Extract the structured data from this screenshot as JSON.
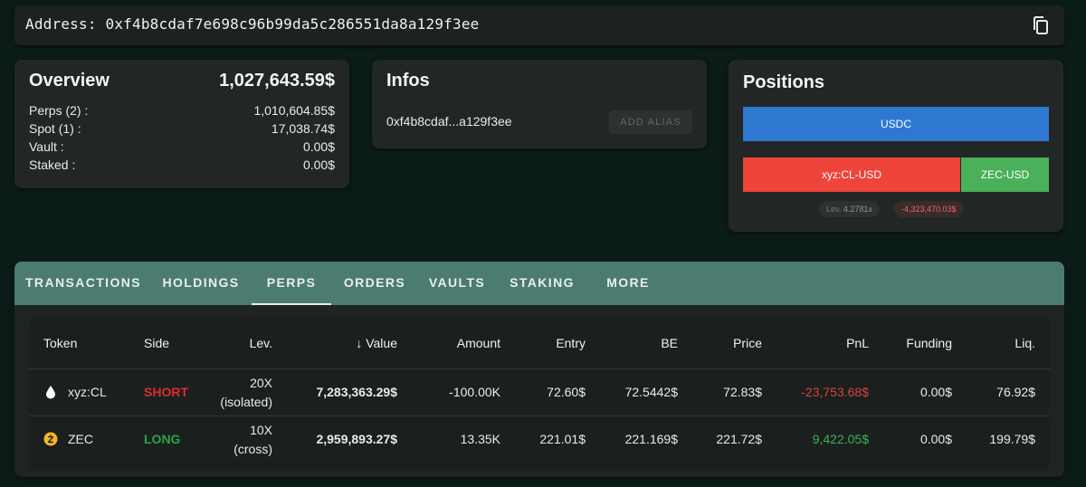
{
  "address_bar": {
    "label": "Address:",
    "address": "0xf4b8cdaf7e698c96b99da5c286551da8a129f3ee"
  },
  "overview": {
    "title": "Overview",
    "total": "1,027,643.59$",
    "rows": [
      {
        "label": "Perps (2) :",
        "value": "1,010,604.85$"
      },
      {
        "label": "Spot (1) :",
        "value": "17,038.74$"
      },
      {
        "label": "Vault :",
        "value": "0.00$"
      },
      {
        "label": "Staked :",
        "value": "0.00$"
      }
    ]
  },
  "infos": {
    "title": "Infos",
    "short_address": "0xf4b8cdaf...a129f3ee",
    "add_alias_label": "ADD ALIAS"
  },
  "positions": {
    "title": "Positions",
    "bars": [
      {
        "label": "USDC",
        "color": "#2f78d2"
      },
      {
        "label": "xyz:CL-USD",
        "color": "#ee4439"
      },
      {
        "label": "ZEC-USD",
        "color": "#4bb05a"
      }
    ],
    "lev_label": "Lev.",
    "lev_value": "4.2781x",
    "pnl_value": "-4,323,470.03$"
  },
  "tabs": [
    {
      "label": "TRANSACTIONS",
      "active": false
    },
    {
      "label": "HOLDINGS",
      "active": false
    },
    {
      "label": "PERPS",
      "active": true
    },
    {
      "label": "ORDERS",
      "active": false
    },
    {
      "label": "VAULTS",
      "active": false
    },
    {
      "label": "STAKING",
      "active": false
    },
    {
      "label": "MORE",
      "active": false
    }
  ],
  "table": {
    "headers": [
      "Token",
      "Side",
      "Lev.",
      "Value",
      "Amount",
      "Entry",
      "BE",
      "Price",
      "PnL",
      "Funding",
      "Liq."
    ],
    "sort_indicator": "↓",
    "rows": [
      {
        "token": "xyz:CL",
        "icon": "oil-drop-icon",
        "side": "SHORT",
        "lev": "20X",
        "lev_mode": "(isolated)",
        "value": "7,283,363.29$",
        "amount": "-100.00K",
        "entry": "72.60$",
        "be": "72.5442$",
        "price": "72.83$",
        "pnl": "-23,753.68$",
        "funding": "0.00$",
        "liq": "76.92$"
      },
      {
        "token": "ZEC",
        "icon": "zcash-coin-icon",
        "side": "LONG",
        "lev": "10X",
        "lev_mode": "(cross)",
        "value": "2,959,893.27$",
        "amount": "13.35K",
        "entry": "221.01$",
        "be": "221.169$",
        "price": "221.72$",
        "pnl": "9,422.05$",
        "funding": "0.00$",
        "liq": "199.79$"
      }
    ]
  },
  "colors": {
    "background": "#0b1c18",
    "card": "#222725",
    "tabbar": "#4c7b72",
    "short": "#e02b2b",
    "long": "#27a44a"
  }
}
